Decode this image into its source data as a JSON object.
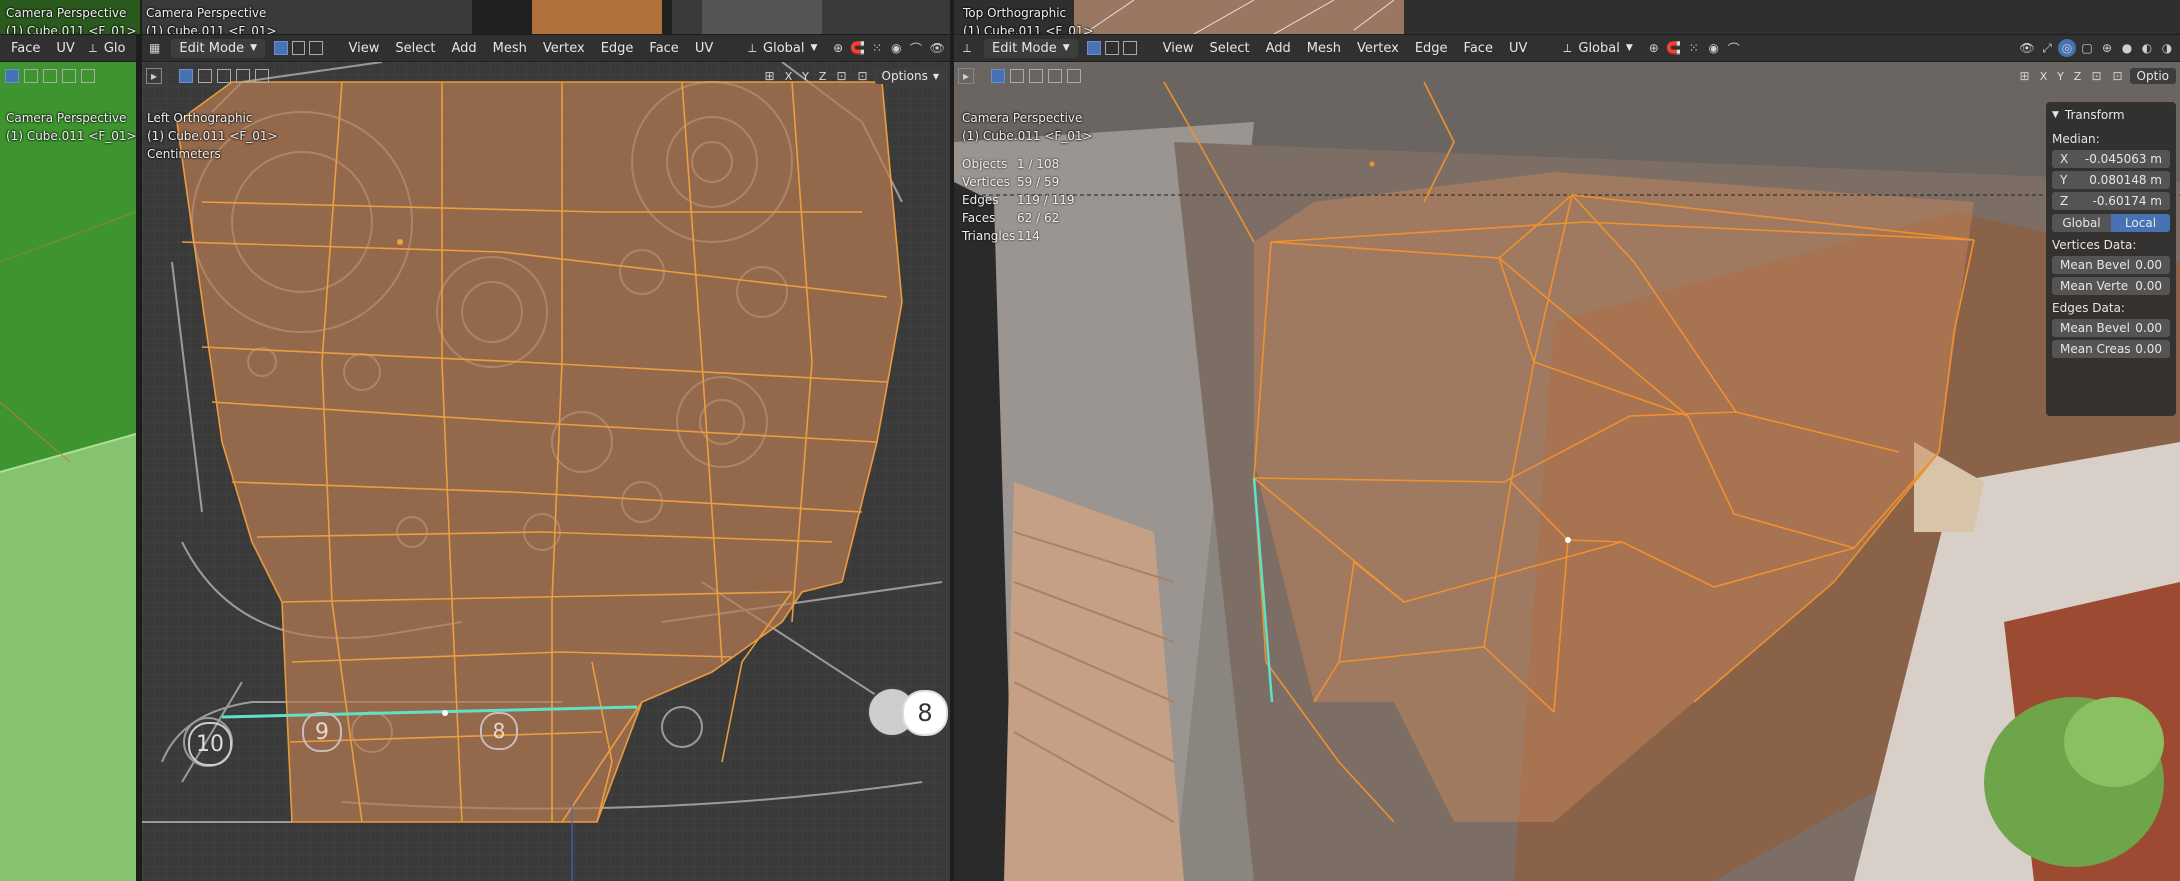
{
  "top_strip": {
    "panels": [
      {
        "title": "Camera Perspective",
        "object": "(1) Cube.011 <F_01>"
      },
      {
        "title": "Camera Perspective",
        "object": "(1) Cube.011 <F_01>"
      },
      {
        "title": "Top Orthographic",
        "object": "(1) Cube.011 <F_01>"
      }
    ]
  },
  "left_header": {
    "menu": [
      "Face",
      "UV"
    ],
    "orientation_short": "Glo"
  },
  "mid_header": {
    "mode": "Edit Mode",
    "menu": [
      "View",
      "Select",
      "Add",
      "Mesh",
      "Vertex",
      "Edge",
      "Face",
      "UV"
    ],
    "orientation": "Global"
  },
  "right_header": {
    "mode": "Edit Mode",
    "menu": [
      "View",
      "Select",
      "Add",
      "Mesh",
      "Vertex",
      "Edge",
      "Face",
      "UV"
    ],
    "orientation": "Global"
  },
  "left_view": {
    "title": "Camera Perspective",
    "object": "(1) Cube.011 <F_01>"
  },
  "mid_view": {
    "title": "Left Orthographic",
    "object": "(1) Cube.011 <F_01>",
    "units": "Centimeters",
    "axes": [
      "X",
      "Y",
      "Z"
    ],
    "options_label": "Options",
    "callouts": [
      "10",
      "9",
      "8",
      "8"
    ]
  },
  "right_view": {
    "title": "Camera Perspective",
    "object": "(1) Cube.011 <F_01>",
    "axes": [
      "X",
      "Y",
      "Z"
    ],
    "options_label": "Optio",
    "stats": [
      {
        "label": "Objects",
        "value": "1 / 108"
      },
      {
        "label": "Vertices",
        "value": "59 / 59"
      },
      {
        "label": "Edges",
        "value": "119 / 119"
      },
      {
        "label": "Faces",
        "value": "62 / 62"
      },
      {
        "label": "Triangles",
        "value": "114"
      }
    ]
  },
  "transform_panel": {
    "title": "Transform",
    "median_label": "Median:",
    "x": {
      "axis": "X",
      "value": "-0.045063 m"
    },
    "y": {
      "axis": "Y",
      "value": "0.080148 m"
    },
    "z": {
      "axis": "Z",
      "value": "-0.60174 m"
    },
    "global_label": "Global",
    "local_label": "Local",
    "vertices_data_label": "Vertices Data:",
    "mean_bevel_v": {
      "label": "Mean Bevel",
      "value": "0.00"
    },
    "mean_vert": {
      "label": "Mean Verte",
      "value": "0.00"
    },
    "edges_data_label": "Edges Data:",
    "mean_bevel_e": {
      "label": "Mean Bevel",
      "value": "0.00"
    },
    "mean_crease": {
      "label": "Mean Creas",
      "value": "0.00"
    }
  },
  "colors": {
    "accent": "#4772b3",
    "mesh_fill": "#b07a52",
    "wire": "#f08a1c",
    "selected_edge": "#5fe0c8"
  }
}
